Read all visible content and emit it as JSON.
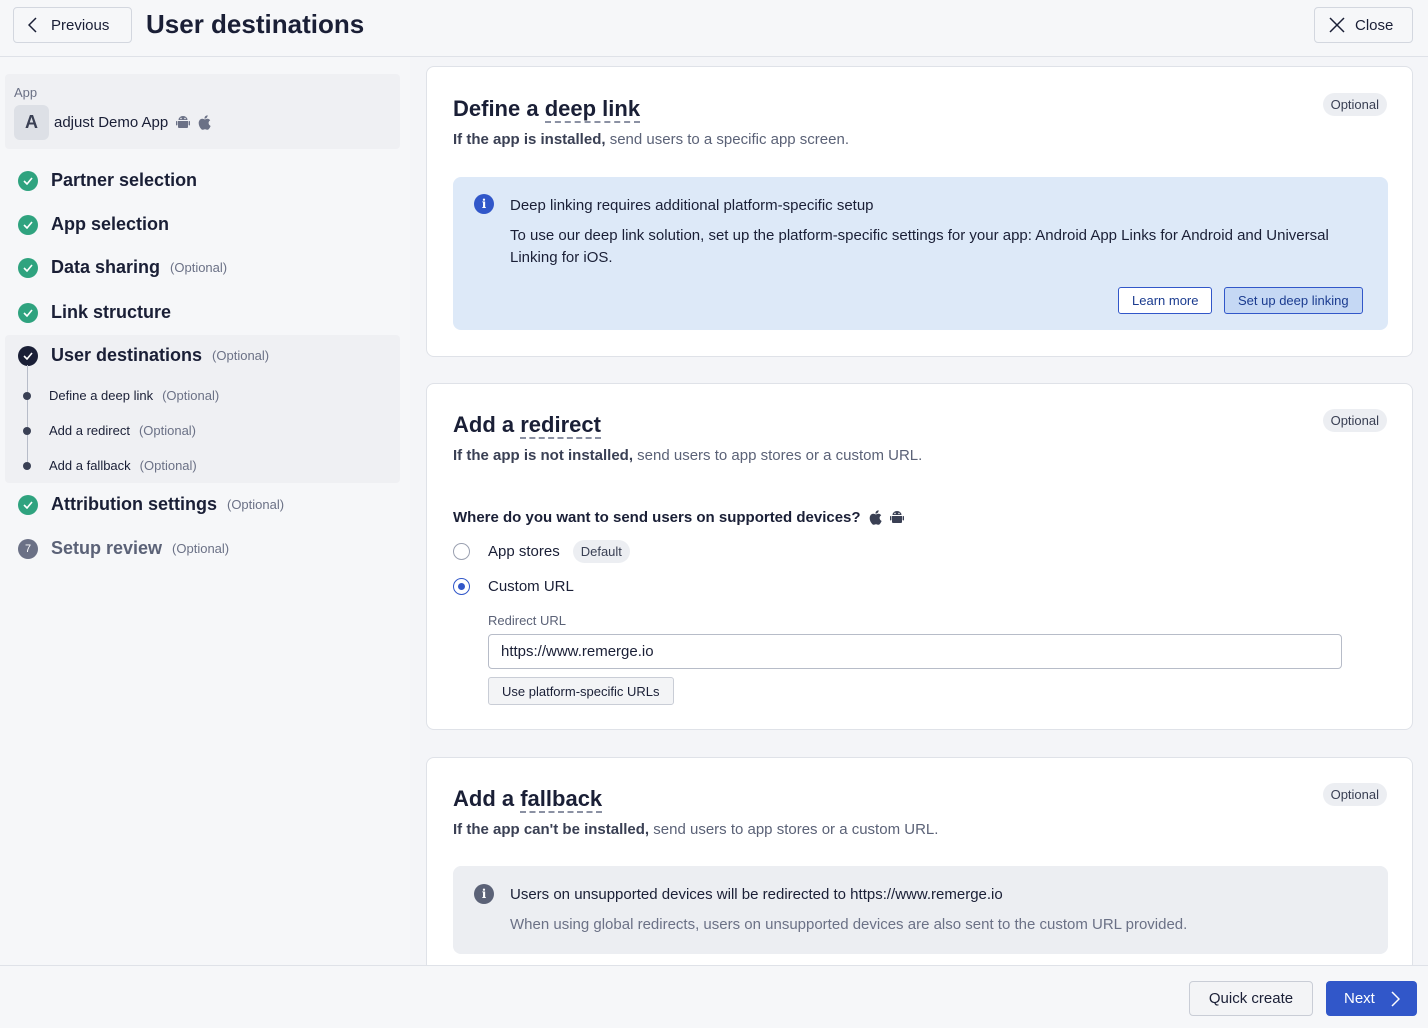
{
  "header": {
    "previous_label": "Previous",
    "title": "User destinations",
    "close_label": "Close"
  },
  "sidebar": {
    "app_label": "App",
    "app_avatar": "A",
    "app_name": "adjust Demo App",
    "app_platform_icons": [
      "android-icon",
      "apple-icon"
    ],
    "steps": [
      {
        "title": "Partner selection",
        "optional": "",
        "status": "done"
      },
      {
        "title": "App selection",
        "optional": "",
        "status": "done"
      },
      {
        "title": "Data sharing",
        "optional": "(Optional)",
        "status": "done"
      },
      {
        "title": "Link structure",
        "optional": "",
        "status": "done"
      },
      {
        "title": "User destinations",
        "optional": "(Optional)",
        "status": "current"
      },
      {
        "title": "Attribution settings",
        "optional": "(Optional)",
        "status": "done"
      },
      {
        "title": "Setup review",
        "optional": "(Optional)",
        "status": "pending",
        "number": "7"
      }
    ],
    "substeps": [
      {
        "title": "Define a deep link",
        "optional": "(Optional)"
      },
      {
        "title": "Add a redirect",
        "optional": "(Optional)"
      },
      {
        "title": "Add a fallback",
        "optional": "(Optional)"
      }
    ]
  },
  "deeplink": {
    "title_prefix": "Define a ",
    "title_term": "deep link",
    "badge": "Optional",
    "sub_bold": "If the app is installed,",
    "sub_rest": " send users to a specific app screen.",
    "info_title": "Deep linking requires additional platform-specific setup",
    "info_text": "To use our deep link solution, set up the platform-specific settings for your app: Android App Links for Android and Universal Linking for iOS.",
    "learn_more": "Learn more",
    "setup_button": "Set up deep linking"
  },
  "redirect": {
    "title_prefix": "Add a ",
    "title_term": "redirect",
    "badge": "Optional",
    "sub_bold": "If the app is not installed,",
    "sub_rest": " send users to app stores or a custom URL.",
    "question": "Where do you want to send users on supported devices?",
    "option_stores": "App stores",
    "default_badge": "Default",
    "option_custom": "Custom URL",
    "selected_option": "Custom URL",
    "url_label": "Redirect URL",
    "url_value": "https://www.remerge.io",
    "platform_button": "Use platform-specific URLs"
  },
  "fallback": {
    "title_prefix": "Add a ",
    "title_term": "fallback",
    "badge": "Optional",
    "sub_bold": "If the app can't be installed,",
    "sub_rest": " send users to app stores or a custom URL.",
    "info_title": "Users on unsupported devices will be redirected to https://www.remerge.io",
    "info_text": "When using global redirects, users on unsupported devices are also sent to the custom URL provided."
  },
  "footer": {
    "quick_create": "Quick create",
    "next": "Next"
  },
  "colors": {
    "accent": "#3157c9",
    "success": "#2fa37f",
    "info_bg": "#dde9f8"
  }
}
